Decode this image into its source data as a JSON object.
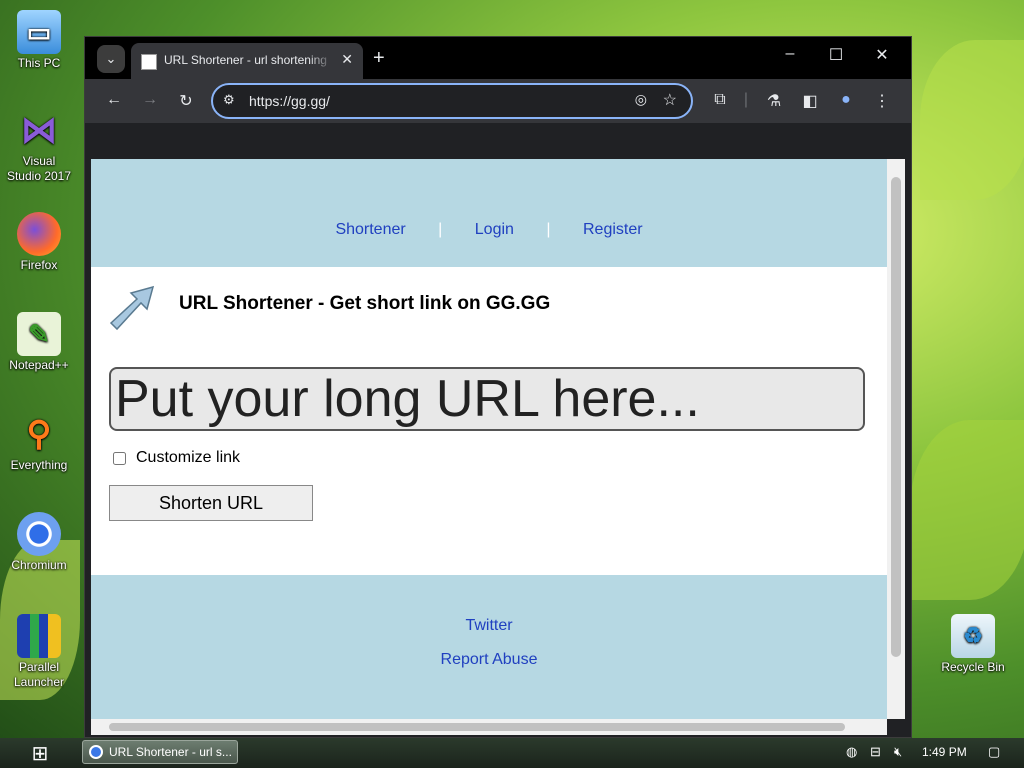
{
  "desktop": {
    "icons": [
      {
        "label": "This PC"
      },
      {
        "label": "Visual Studio 2017"
      },
      {
        "label": "Firefox"
      },
      {
        "label": "Notepad++"
      },
      {
        "label": "Everything"
      },
      {
        "label": "Chromium"
      },
      {
        "label": "Parallel Launcher"
      }
    ],
    "recycle_bin": "Recycle Bin"
  },
  "browser": {
    "tab": {
      "title": "URL Shortener - url shortening"
    },
    "address": {
      "value": "https://gg.gg/"
    }
  },
  "page": {
    "nav": [
      "Shortener",
      "Login",
      "Register"
    ],
    "nav_separator": "|",
    "title": "URL Shortener - Get short link on GG.GG",
    "url_input": {
      "placeholder": "Put your long URL here..."
    },
    "customize_label": "Customize link",
    "shorten_button": "Shorten URL",
    "footer_links": [
      "Twitter",
      "Report Abuse"
    ]
  },
  "taskbar": {
    "task_title": "URL Shortener - url s...",
    "clock": "1:49 PM"
  },
  "colors": {
    "header_bg": "#b6d8e3",
    "link": "#2040c0",
    "omnibox_focus": "#8ab4f8"
  }
}
